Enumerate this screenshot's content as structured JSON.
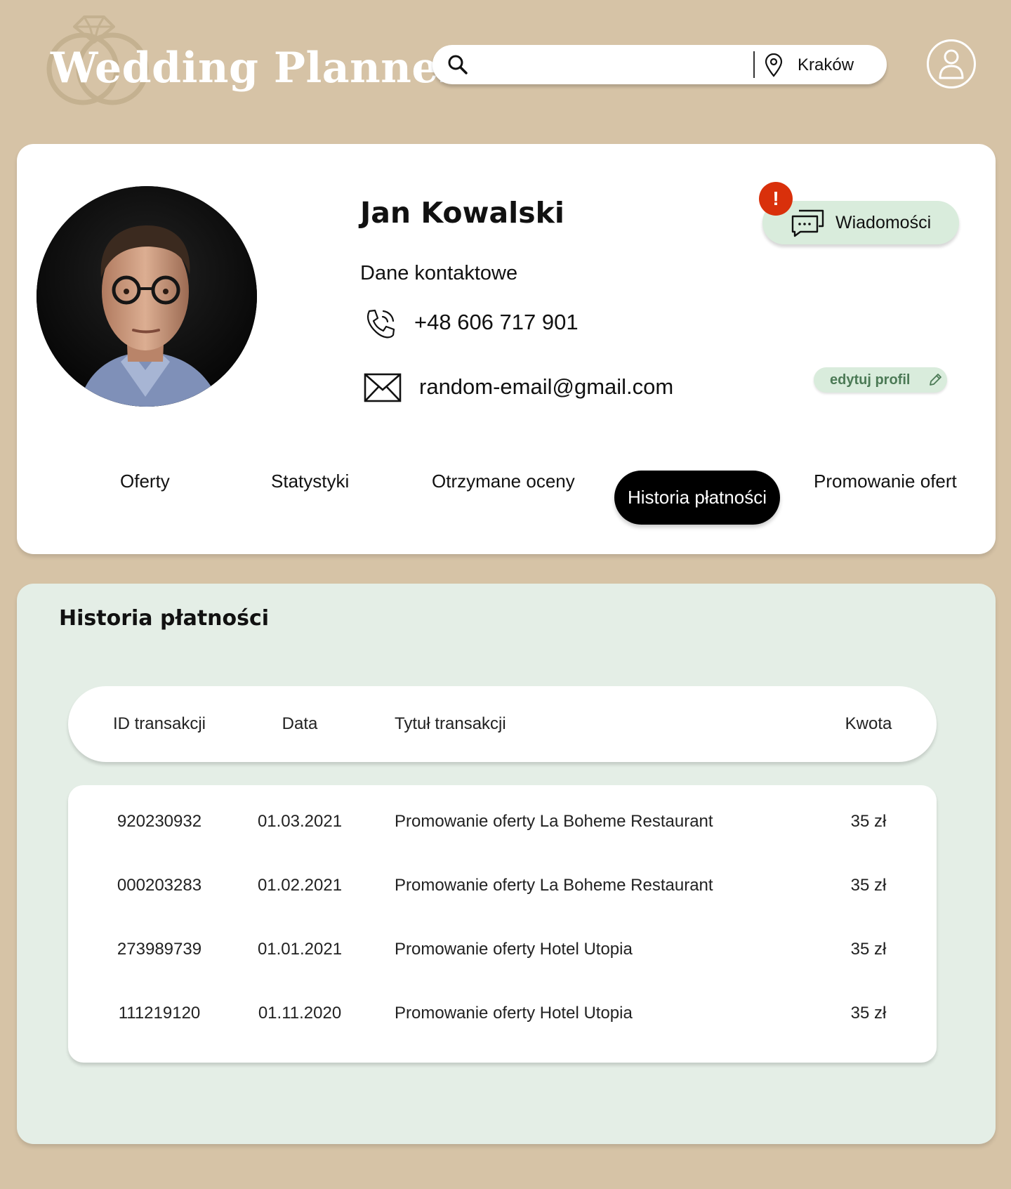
{
  "header": {
    "logo_text": "Wedding Planner",
    "search": {
      "placeholder": "",
      "value": "",
      "location": "Kraków"
    }
  },
  "profile": {
    "name": "Jan Kowalski",
    "contact_heading": "Dane kontaktowe",
    "phone": "+48 606 717 901",
    "email": "random-email@gmail.com",
    "messages_label": "Wiadomości",
    "messages_badge": "!",
    "edit_label": "edytuj profil",
    "tabs": [
      {
        "label": "Oferty"
      },
      {
        "label": "Statystyki"
      },
      {
        "label": "Otrzymane oceny"
      },
      {
        "label": "Historia płatności"
      },
      {
        "label": "Promowanie ofert"
      }
    ],
    "active_tab": "Historia płatności"
  },
  "history": {
    "title": "Historia płatności",
    "columns": [
      "ID transakcji",
      "Data",
      "Tytuł transakcji",
      "Kwota"
    ],
    "rows": [
      {
        "id": "920230932",
        "date": "01.03.2021",
        "title": "Promowanie oferty La Boheme Restaurant",
        "amount": "35 zł"
      },
      {
        "id": "000203283",
        "date": "01.02.2021",
        "title": "Promowanie oferty La Boheme Restaurant",
        "amount": "35 zł"
      },
      {
        "id": "273989739",
        "date": "01.01.2021",
        "title": "Promowanie oferty Hotel Utopia",
        "amount": "35 zł"
      },
      {
        "id": "111219120",
        "date": "01.11.2020",
        "title": "Promowanie oferty Hotel Utopia",
        "amount": "35 zł"
      }
    ]
  },
  "colors": {
    "page_bg": "#d6c3a6",
    "card_bg": "#ffffff",
    "history_bg": "#e4eee6",
    "mint_button": "#d9ecdc",
    "badge_red": "#d9300b",
    "active_tab_bg": "#000000"
  },
  "icons": {
    "search": "search-icon",
    "location": "location-pin-icon",
    "user": "user-account-icon",
    "phone": "phone-icon",
    "mail": "mail-icon",
    "messages": "chat-bubbles-icon",
    "edit": "pencil-icon"
  }
}
